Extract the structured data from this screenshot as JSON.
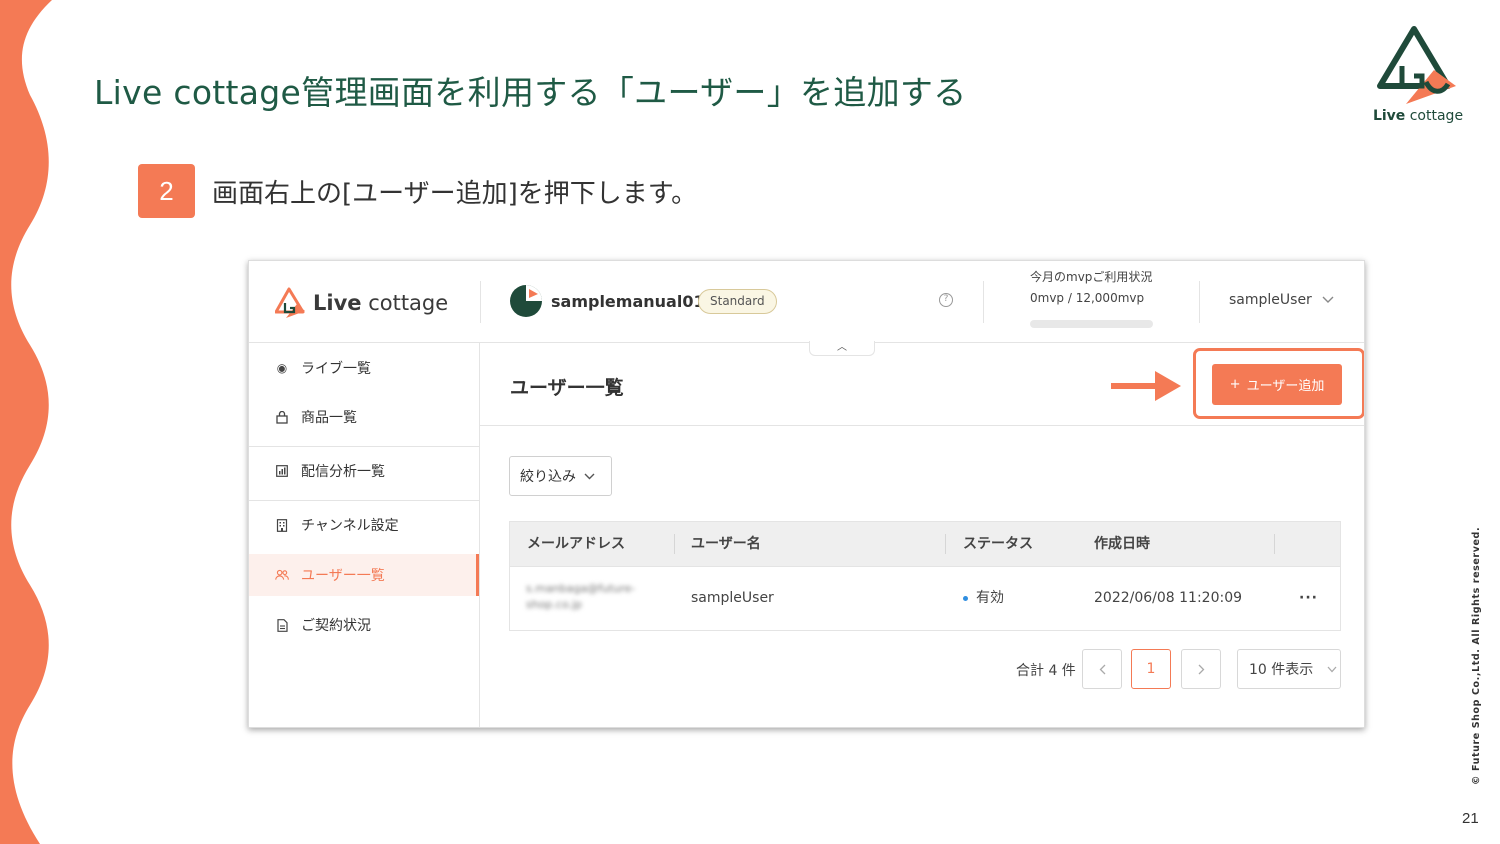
{
  "slide": {
    "title": "Live cottage管理画面を利用する「ユーザー」を追加する",
    "step_number": "2",
    "step_text": "画面右上の[ユーザー追加]を押下します。",
    "logo_bold": "Live",
    "logo_rest": " cottage",
    "copyright": "© Future Shop Co.,Ltd. All Rights reserved.",
    "page_number": "21",
    "accent_color": "#f47a55",
    "title_color": "#1f5a45"
  },
  "app": {
    "logo_bold": "Live",
    "logo_rest": " cottage",
    "account_name": "samplemanual01",
    "plan": "Standard",
    "usage_label": "今月のmvpご利用状況",
    "usage_value": "0mvp / 12,000mvp",
    "usage_fraction": 0,
    "user_name": "sampleUser",
    "sidebar": [
      {
        "label": "ライブ一覧",
        "icon": "play-circle-icon"
      },
      {
        "label": "商品一覧",
        "icon": "bag-icon"
      },
      {
        "label": "配信分析一覧",
        "icon": "chart-icon"
      },
      {
        "label": "チャンネル設定",
        "icon": "building-icon"
      },
      {
        "label": "ユーザー一覧",
        "icon": "users-icon",
        "active": true
      },
      {
        "label": "ご契約状況",
        "icon": "document-icon"
      }
    ],
    "page_title": "ユーザー一覧",
    "add_button": "ユーザー追加",
    "filter_label": "絞り込み",
    "table": {
      "headers": [
        "メールアドレス",
        "ユーザー名",
        "ステータス",
        "作成日時"
      ],
      "rows": [
        {
          "email_line1": "s.manbaga@future-",
          "email_line2": "shop.co.jp",
          "username": "sampleUser",
          "status": "有効",
          "created": "2022/06/08 11:20:09"
        }
      ]
    },
    "pagination": {
      "total": "合計 4 件",
      "current_page": "1",
      "per_page": "10 件表示"
    }
  }
}
